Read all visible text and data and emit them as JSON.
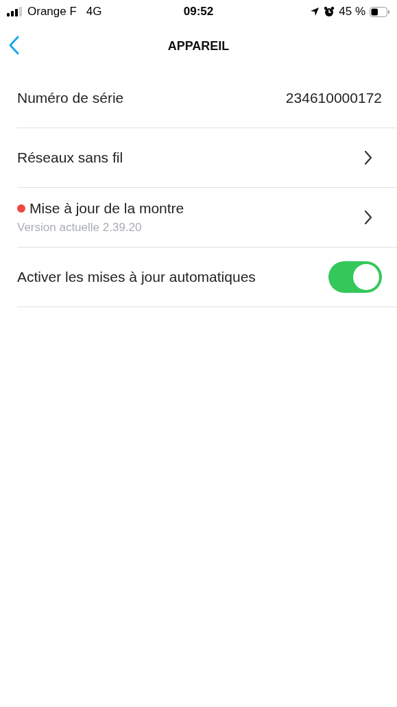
{
  "status_bar": {
    "carrier": "Orange F",
    "network": "4G",
    "time": "09:52",
    "battery": "45 %"
  },
  "nav": {
    "title": "APPAREIL"
  },
  "rows": [
    {
      "kind": "value",
      "label": "Numéro de série",
      "value": "234610000172"
    },
    {
      "kind": "link",
      "label": "Réseaux sans fil"
    },
    {
      "kind": "link",
      "label": "Mise à jour de la montre",
      "subtitle": "Version actuelle 2.39.20",
      "notification": true
    },
    {
      "kind": "toggle",
      "label": "Activer les mises à jour automatiques",
      "on": true
    }
  ]
}
